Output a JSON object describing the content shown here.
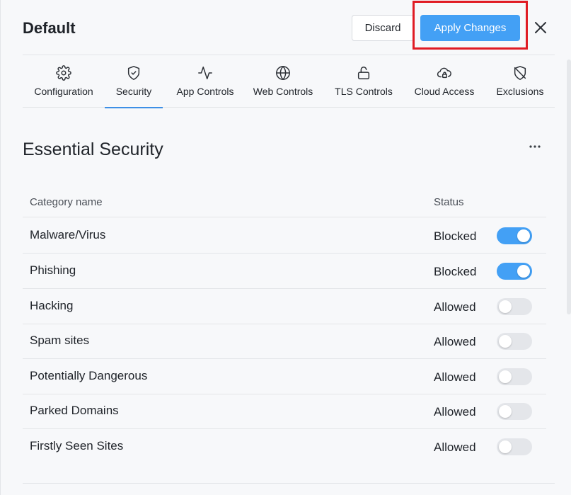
{
  "header": {
    "title": "Default",
    "discard_label": "Discard",
    "apply_label": "Apply Changes",
    "close_icon": "close-icon"
  },
  "tabs": [
    {
      "label": "Configuration",
      "icon": "gear-icon",
      "active": false
    },
    {
      "label": "Security",
      "icon": "shield-check-icon",
      "active": true
    },
    {
      "label": "App Controls",
      "icon": "activity-icon",
      "active": false
    },
    {
      "label": "Web Controls",
      "icon": "globe-icon",
      "active": false
    },
    {
      "label": "TLS Controls",
      "icon": "unlock-icon",
      "active": false
    },
    {
      "label": "Cloud Access",
      "icon": "cloud-lock-icon",
      "active": false
    },
    {
      "label": "Exclusions",
      "icon": "shield-off-icon",
      "active": false
    }
  ],
  "section": {
    "title": "Essential Security",
    "more_icon": "more-horizontal-icon"
  },
  "table": {
    "headers": {
      "name": "Category name",
      "status": "Status"
    },
    "rows": [
      {
        "name": "Malware/Virus",
        "status": "Blocked",
        "enabled": true
      },
      {
        "name": "Phishing",
        "status": "Blocked",
        "enabled": true
      },
      {
        "name": "Hacking",
        "status": "Allowed",
        "enabled": false
      },
      {
        "name": "Spam sites",
        "status": "Allowed",
        "enabled": false
      },
      {
        "name": "Potentially Dangerous",
        "status": "Allowed",
        "enabled": false
      },
      {
        "name": "Parked Domains",
        "status": "Allowed",
        "enabled": false
      },
      {
        "name": "Firstly Seen Sites",
        "status": "Allowed",
        "enabled": false
      }
    ]
  },
  "colors": {
    "accent": "#43a0f5",
    "highlight_border": "#e01b24",
    "toggle_off": "#e4e6ea"
  }
}
